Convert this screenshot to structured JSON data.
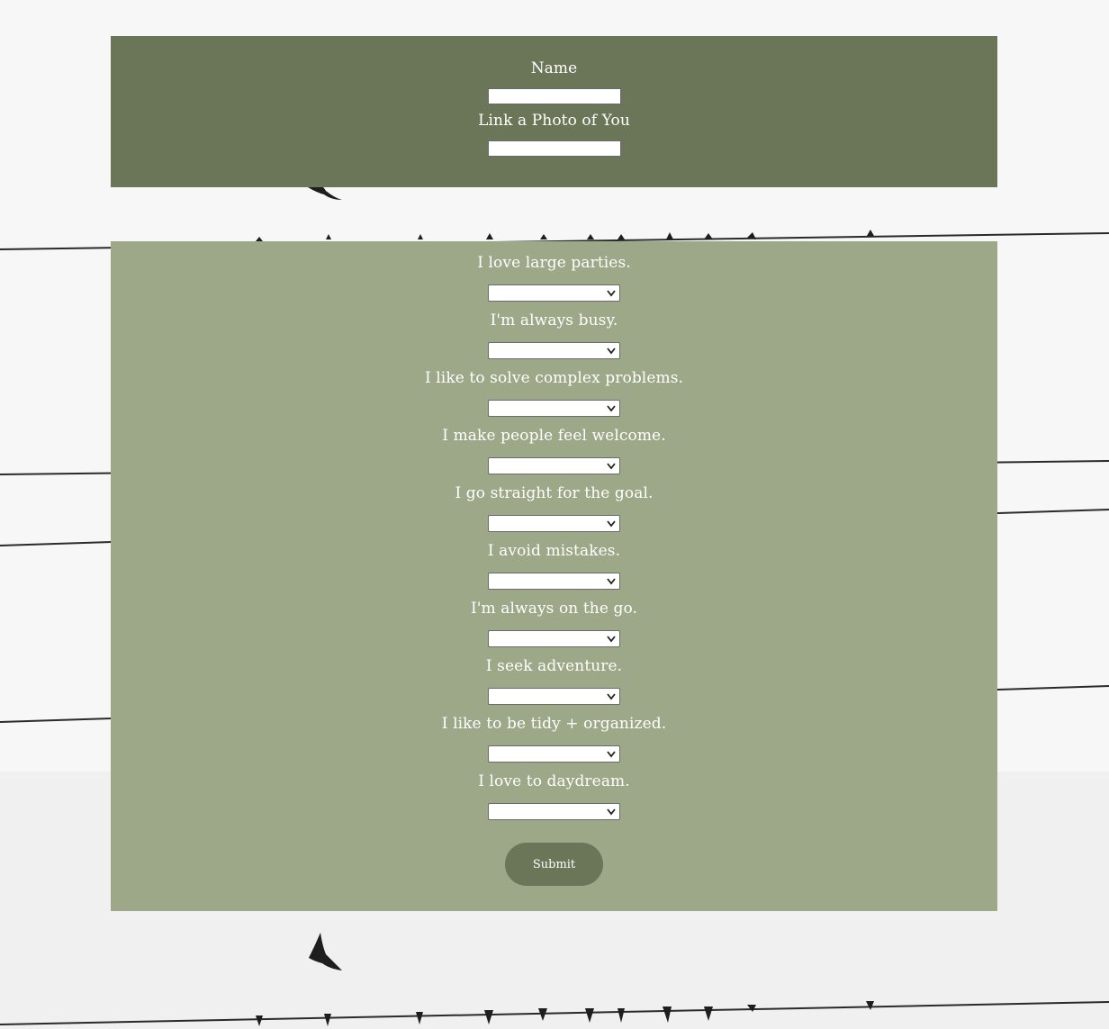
{
  "profile": {
    "name_label": "Name",
    "photo_label": "Link a Photo of You",
    "name_value": "",
    "photo_value": ""
  },
  "questions": [
    {
      "label": "I love large parties.",
      "selected": ""
    },
    {
      "label": "I'm always busy.",
      "selected": ""
    },
    {
      "label": "I like to solve complex problems.",
      "selected": ""
    },
    {
      "label": "I make people feel welcome.",
      "selected": ""
    },
    {
      "label": "I go straight for the goal.",
      "selected": ""
    },
    {
      "label": "I avoid mistakes.",
      "selected": ""
    },
    {
      "label": "I'm always on the go.",
      "selected": ""
    },
    {
      "label": "I seek adventure.",
      "selected": ""
    },
    {
      "label": "I like to be tidy + organized.",
      "selected": ""
    },
    {
      "label": "I love to daydream.",
      "selected": ""
    }
  ],
  "submit_label": "Submit",
  "icons": {
    "select_arrow": "chevron-down-icon"
  },
  "colors": {
    "top_panel": "#6a7657",
    "quiz_panel": "#9ca887",
    "button": "#6a7657",
    "text": "#ffffff"
  }
}
